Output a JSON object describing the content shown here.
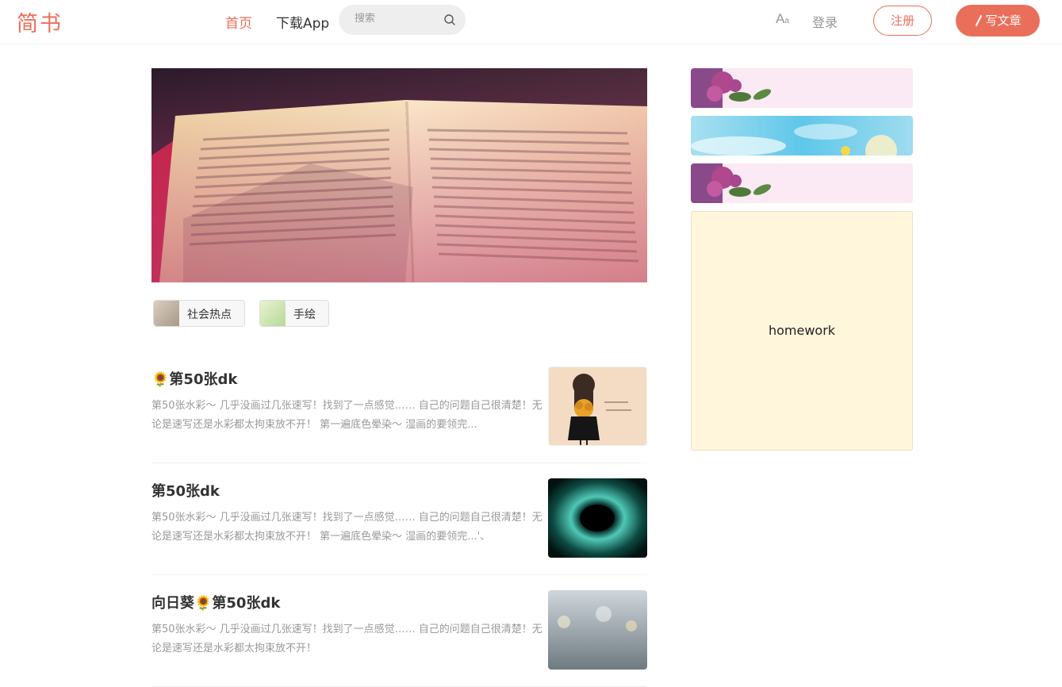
{
  "nav": {
    "logo": "简书",
    "home": "首页",
    "download_app": "下载App",
    "search_placeholder": "搜索",
    "font_size_icon": "Aa",
    "login": "登录",
    "signup": "注册",
    "write": "写文章",
    "write_icon": "pen-icon",
    "accent_color": "#ea6f5a"
  },
  "tags": [
    {
      "label": "社会热点"
    },
    {
      "label": "手绘"
    }
  ],
  "articles": [
    {
      "emoji": "🌻",
      "title": "第50张dk",
      "abstract": "第50张水彩～ 几乎没画过几张速写！找到了一点感觉…… 自己的问题自己很清楚！无论是速写还是水彩都太拘束放不开！  第一遍底色晕染～ 湿画的要领完..."
    },
    {
      "emoji": "",
      "title": "第50张dk",
      "abstract": "第50张水彩～ 几乎没画过几张速写！找到了一点感觉…… 自己的问题自己很清楚！无论是速写还是水彩都太拘束放不开！  第一遍底色晕染～ 湿画的要领完...'、"
    },
    {
      "emoji": "",
      "title": "向日葵🌻第50张dk",
      "abstract": "第50张水彩～ 几乎没画过几张速写！找到了一点感觉…… 自己的问题自己很清楚！无论是速写还是水彩都太拘束放不开！"
    }
  ],
  "sidebar": {
    "homework": "homework"
  }
}
